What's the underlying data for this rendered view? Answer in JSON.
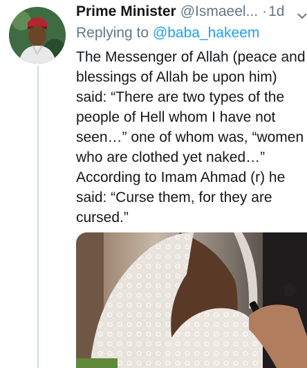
{
  "tweet": {
    "author": {
      "display_name": "Prime Minister",
      "handle": "@Ismaeel...",
      "avatar_icon": "profile-photo"
    },
    "separator": "·",
    "timestamp": "1d",
    "reply_to": {
      "prefix": "Replying to",
      "handle": "@baba_hakeem"
    },
    "text_lines": [
      "The Messenger of Allah (peace and",
      "blessings of Allah be upon him)",
      "said: “There are two types of the",
      "people of Hell whom I have not",
      "seen…” one of whom was, “women",
      "who are clothed yet naked…”",
      "According to Imam Ahmad (r) he",
      "said: “Curse them, for they are",
      "cursed.”"
    ],
    "media": {
      "type": "photo",
      "subject": "bride-in-lace-veil-with-makeup-brush"
    }
  },
  "colors": {
    "text": "#14171a",
    "secondary": "#657786",
    "link": "#1da1f2",
    "thread_line": "#cfd9de"
  },
  "icons": {
    "menu": "chevron-down-icon"
  }
}
